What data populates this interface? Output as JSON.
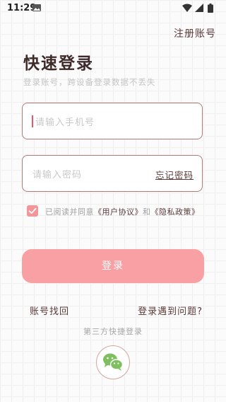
{
  "status_bar": {
    "time": "11:29"
  },
  "header": {
    "register_link": "注册账号"
  },
  "main": {
    "title": "快速登录",
    "subtitle": "登录账号，跨设备登录数据不丢失"
  },
  "phone_field": {
    "placeholder": "请输入手机号"
  },
  "password_field": {
    "placeholder": "请输入密码",
    "forgot_link": "忘记密码"
  },
  "agreement": {
    "checked": true,
    "prefix": "已阅读并同意",
    "user_agreement": "《用户协议》",
    "and": "和",
    "privacy_policy": "《隐私政策》"
  },
  "login_button": {
    "label": "登录"
  },
  "links": {
    "account_recovery": "账号找回",
    "login_problem": "登录遇到问题?"
  },
  "third_party": {
    "label": "第三方快捷登录",
    "providers": [
      "wechat"
    ]
  },
  "colors": {
    "accent": "#f8a0a3",
    "text": "#5a3a38",
    "checkbox": "#f29699",
    "wechat": "#7fbf5f"
  }
}
